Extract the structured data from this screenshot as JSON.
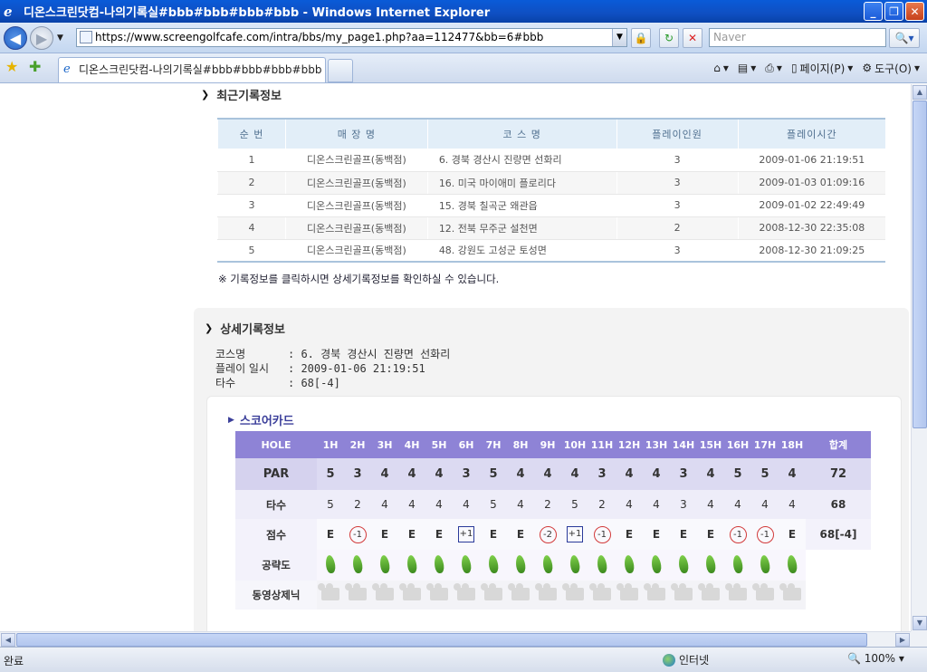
{
  "window": {
    "title": "디온스크린닷컴-나의기록실#bbb#bbb#bbb#bbb - Windows Internet Explorer"
  },
  "address": {
    "url": "https://www.screengolfcafe.com/intra/bbs/my_page1.php?aa=112477&bb=6#bbb",
    "search_placeholder": "Naver"
  },
  "tab": {
    "label": "디온스크린닷컴-나의기록실#bbb#bbb#bbb#bbb"
  },
  "toolbar": {
    "page_label": "페이지(P)",
    "tools_label": "도구(O)"
  },
  "recent": {
    "title": "최근기록정보",
    "headers": [
      "순 번",
      "매 장 명",
      "코 스 명",
      "플레이인원",
      "플레이시간"
    ],
    "rows": [
      [
        "1",
        "디온스크린골프(동백점)",
        "6. 경북 경산시 진량면 선화리",
        "3",
        "2009-01-06 21:19:51"
      ],
      [
        "2",
        "디온스크린골프(동백점)",
        "16. 미국 마이애미 플로리다",
        "3",
        "2009-01-03 01:09:16"
      ],
      [
        "3",
        "디온스크린골프(동백점)",
        "15. 경북 칠곡군 왜관읍",
        "3",
        "2009-01-02 22:49:49"
      ],
      [
        "4",
        "디온스크린골프(동백점)",
        "12. 전북 무주군 설천면",
        "2",
        "2008-12-30 22:35:08"
      ],
      [
        "5",
        "디온스크린골프(동백점)",
        "48. 강원도 고성군 토성면",
        "3",
        "2008-12-30 21:09:25"
      ]
    ],
    "note": "※ 기록정보를 클릭하시면 상세기록정보를 확인하실 수 있습니다."
  },
  "detail": {
    "title": "상세기록정보",
    "course_label": "코스명",
    "course_value": ": 6. 경북 경산시 진량면 선화리",
    "date_label": "플레이 일시",
    "date_value": ": 2009-01-06 21:19:51",
    "strokes_label": "타수",
    "strokes_value": ": 68[-4]"
  },
  "scorecard": {
    "title": "스코어카드",
    "hole_label": "HOLE",
    "holes": [
      "1H",
      "2H",
      "3H",
      "4H",
      "5H",
      "6H",
      "7H",
      "8H",
      "9H",
      "10H",
      "11H",
      "12H",
      "13H",
      "14H",
      "15H",
      "16H",
      "17H",
      "18H"
    ],
    "total_label": "합계",
    "par_label": "PAR",
    "par": [
      "5",
      "3",
      "4",
      "4",
      "4",
      "3",
      "5",
      "4",
      "4",
      "4",
      "3",
      "4",
      "4",
      "3",
      "4",
      "5",
      "5",
      "4"
    ],
    "par_total": "72",
    "strokes_label": "타수",
    "strokes": [
      "5",
      "2",
      "4",
      "4",
      "4",
      "4",
      "5",
      "4",
      "2",
      "5",
      "2",
      "4",
      "4",
      "3",
      "4",
      "4",
      "4",
      "4"
    ],
    "strokes_total": "68",
    "score_label": "점수",
    "scores": [
      "E",
      "-1",
      "E",
      "E",
      "E",
      "+1",
      "E",
      "E",
      "-2",
      "+1",
      "-1",
      "E",
      "E",
      "E",
      "E",
      "-1",
      "-1",
      "E"
    ],
    "score_total": "68[-4]",
    "difficulty_label": "공략도",
    "movie_label": "동영상제닉"
  },
  "status": {
    "text": "완료",
    "zone": "인터넷",
    "zoom": "100%"
  }
}
